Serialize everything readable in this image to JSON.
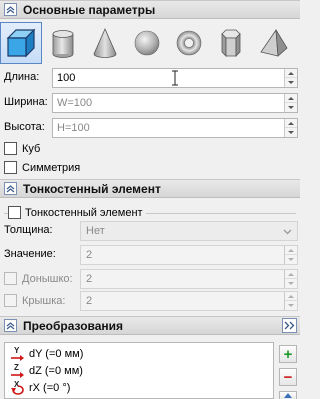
{
  "sections": {
    "main": {
      "title": "Основные параметры"
    },
    "thin": {
      "title": "Тонкостенный элемент"
    },
    "transform": {
      "title": "Преобразования"
    }
  },
  "shapes": [
    {
      "name": "box",
      "active": true
    },
    {
      "name": "cylinder",
      "active": false
    },
    {
      "name": "cone",
      "active": false
    },
    {
      "name": "sphere",
      "active": false
    },
    {
      "name": "torus",
      "active": false
    },
    {
      "name": "prism",
      "active": false
    },
    {
      "name": "pyramid",
      "active": false
    }
  ],
  "params": {
    "length": {
      "label": "Длина:",
      "value": "100"
    },
    "width": {
      "label": "Ширина:",
      "value": "W=100"
    },
    "height": {
      "label": "Высота:",
      "value": "H=100"
    }
  },
  "options": {
    "cube": {
      "label": "Куб",
      "checked": false
    },
    "symmetry": {
      "label": "Симметрия",
      "checked": false
    }
  },
  "thin": {
    "checkbox_label": "Тонкостенный элемент",
    "checked": false,
    "thickness": {
      "label": "Толщина:",
      "value": "Нет"
    },
    "value": {
      "label": "Значение:",
      "value": "2"
    },
    "bottom": {
      "label": "Донышко:",
      "value": "2"
    },
    "lid": {
      "label": "Крышка:",
      "value": "2"
    }
  },
  "transforms": [
    {
      "label": "dY (=0 мм)",
      "axis": "Y"
    },
    {
      "label": "dZ (=0 мм)",
      "axis": "Z"
    },
    {
      "label": "rX (=0 °)",
      "axis": "X"
    }
  ],
  "transform_buttons": {
    "add": "+",
    "remove": "−"
  },
  "colors": {
    "accent": "#5b86c4",
    "add": "#1f9a2a",
    "remove": "#c81e1e"
  }
}
